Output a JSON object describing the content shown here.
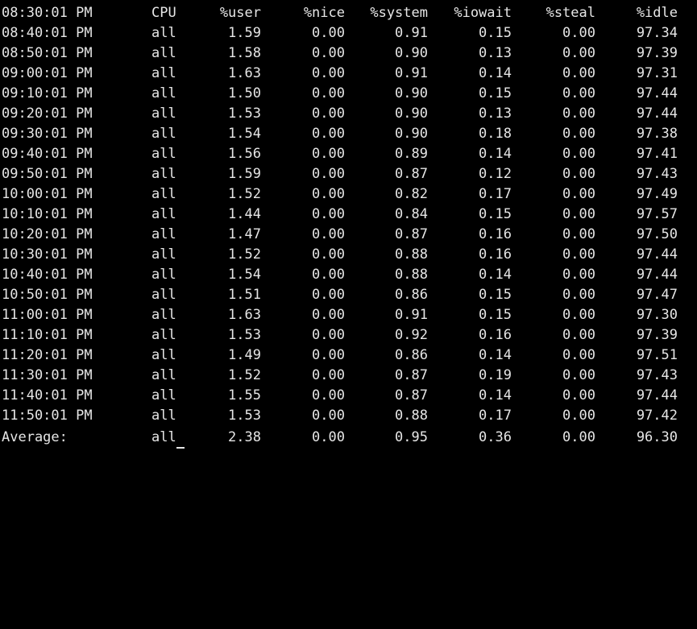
{
  "header": {
    "time": "08:30:01 PM",
    "cpu": "CPU",
    "user": "%user",
    "nice": "%nice",
    "system": "%system",
    "iowait": "%iowait",
    "steal": "%steal",
    "idle": "%idle"
  },
  "rows": [
    {
      "time": "08:40:01 PM",
      "cpu": "all",
      "user": "1.59",
      "nice": "0.00",
      "system": "0.91",
      "iowait": "0.15",
      "steal": "0.00",
      "idle": "97.34"
    },
    {
      "time": "08:50:01 PM",
      "cpu": "all",
      "user": "1.58",
      "nice": "0.00",
      "system": "0.90",
      "iowait": "0.13",
      "steal": "0.00",
      "idle": "97.39"
    },
    {
      "time": "09:00:01 PM",
      "cpu": "all",
      "user": "1.63",
      "nice": "0.00",
      "system": "0.91",
      "iowait": "0.14",
      "steal": "0.00",
      "idle": "97.31"
    },
    {
      "time": "09:10:01 PM",
      "cpu": "all",
      "user": "1.50",
      "nice": "0.00",
      "system": "0.90",
      "iowait": "0.15",
      "steal": "0.00",
      "idle": "97.44"
    },
    {
      "time": "09:20:01 PM",
      "cpu": "all",
      "user": "1.53",
      "nice": "0.00",
      "system": "0.90",
      "iowait": "0.13",
      "steal": "0.00",
      "idle": "97.44"
    },
    {
      "time": "09:30:01 PM",
      "cpu": "all",
      "user": "1.54",
      "nice": "0.00",
      "system": "0.90",
      "iowait": "0.18",
      "steal": "0.00",
      "idle": "97.38"
    },
    {
      "time": "09:40:01 PM",
      "cpu": "all",
      "user": "1.56",
      "nice": "0.00",
      "system": "0.89",
      "iowait": "0.14",
      "steal": "0.00",
      "idle": "97.41"
    },
    {
      "time": "09:50:01 PM",
      "cpu": "all",
      "user": "1.59",
      "nice": "0.00",
      "system": "0.87",
      "iowait": "0.12",
      "steal": "0.00",
      "idle": "97.43"
    },
    {
      "time": "10:00:01 PM",
      "cpu": "all",
      "user": "1.52",
      "nice": "0.00",
      "system": "0.82",
      "iowait": "0.17",
      "steal": "0.00",
      "idle": "97.49"
    },
    {
      "time": "10:10:01 PM",
      "cpu": "all",
      "user": "1.44",
      "nice": "0.00",
      "system": "0.84",
      "iowait": "0.15",
      "steal": "0.00",
      "idle": "97.57"
    },
    {
      "time": "10:20:01 PM",
      "cpu": "all",
      "user": "1.47",
      "nice": "0.00",
      "system": "0.87",
      "iowait": "0.16",
      "steal": "0.00",
      "idle": "97.50"
    },
    {
      "time": "10:30:01 PM",
      "cpu": "all",
      "user": "1.52",
      "nice": "0.00",
      "system": "0.88",
      "iowait": "0.16",
      "steal": "0.00",
      "idle": "97.44"
    },
    {
      "time": "10:40:01 PM",
      "cpu": "all",
      "user": "1.54",
      "nice": "0.00",
      "system": "0.88",
      "iowait": "0.14",
      "steal": "0.00",
      "idle": "97.44"
    },
    {
      "time": "10:50:01 PM",
      "cpu": "all",
      "user": "1.51",
      "nice": "0.00",
      "system": "0.86",
      "iowait": "0.15",
      "steal": "0.00",
      "idle": "97.47"
    },
    {
      "time": "11:00:01 PM",
      "cpu": "all",
      "user": "1.63",
      "nice": "0.00",
      "system": "0.91",
      "iowait": "0.15",
      "steal": "0.00",
      "idle": "97.30"
    },
    {
      "time": "11:10:01 PM",
      "cpu": "all",
      "user": "1.53",
      "nice": "0.00",
      "system": "0.92",
      "iowait": "0.16",
      "steal": "0.00",
      "idle": "97.39"
    },
    {
      "time": "11:20:01 PM",
      "cpu": "all",
      "user": "1.49",
      "nice": "0.00",
      "system": "0.86",
      "iowait": "0.14",
      "steal": "0.00",
      "idle": "97.51"
    },
    {
      "time": "11:30:01 PM",
      "cpu": "all",
      "user": "1.52",
      "nice": "0.00",
      "system": "0.87",
      "iowait": "0.19",
      "steal": "0.00",
      "idle": "97.43"
    },
    {
      "time": "11:40:01 PM",
      "cpu": "all",
      "user": "1.55",
      "nice": "0.00",
      "system": "0.87",
      "iowait": "0.14",
      "steal": "0.00",
      "idle": "97.44"
    },
    {
      "time": "11:50:01 PM",
      "cpu": "all",
      "user": "1.53",
      "nice": "0.00",
      "system": "0.88",
      "iowait": "0.17",
      "steal": "0.00",
      "idle": "97.42"
    }
  ],
  "average": {
    "time": "Average:",
    "cpu": "all",
    "user": "2.38",
    "nice": "0.00",
    "system": "0.95",
    "iowait": "0.36",
    "steal": "0.00",
    "idle": "96.30"
  },
  "colors": {
    "background": "#000000",
    "text": "#e6e6e6"
  }
}
